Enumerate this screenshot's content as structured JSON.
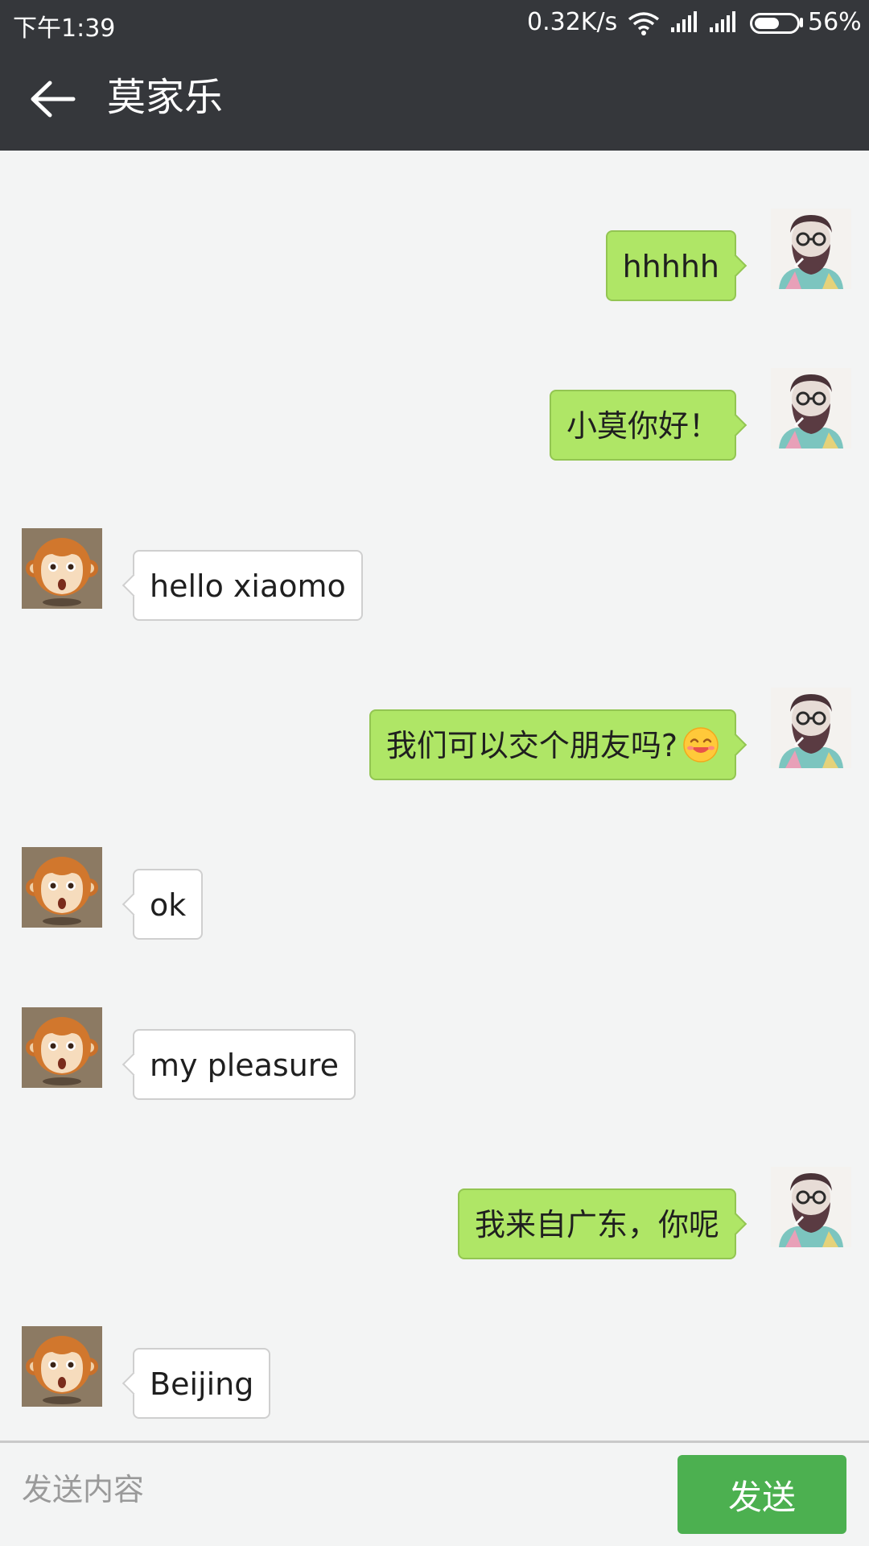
{
  "status_bar": {
    "time": "下午1:39",
    "network_speed": "0.32K/s",
    "battery_percent": "56%",
    "battery_level": 0.56
  },
  "header": {
    "title": "莫家乐",
    "back_icon": "arrow-left-icon"
  },
  "messages": [
    {
      "sender": "me",
      "text": "hhhhh"
    },
    {
      "sender": "me",
      "text": "小莫你好！"
    },
    {
      "sender": "other",
      "text": "hello xiaomo"
    },
    {
      "sender": "me",
      "text": "我们可以交个朋友吗?",
      "emoji": "smiling-face-emoji"
    },
    {
      "sender": "other",
      "text": "ok"
    },
    {
      "sender": "other",
      "text": "my pleasure"
    },
    {
      "sender": "me",
      "text": "我来自广东，你呢"
    },
    {
      "sender": "other",
      "text": "Beijing"
    }
  ],
  "composer": {
    "placeholder": "发送内容",
    "value": "",
    "send_label": "发送"
  },
  "colors": {
    "bar_bg": "#35373b",
    "chat_bg": "#f3f4f4",
    "my_bubble": "#afe666",
    "their_bubble": "#ffffff",
    "send_button": "#4cb050"
  }
}
